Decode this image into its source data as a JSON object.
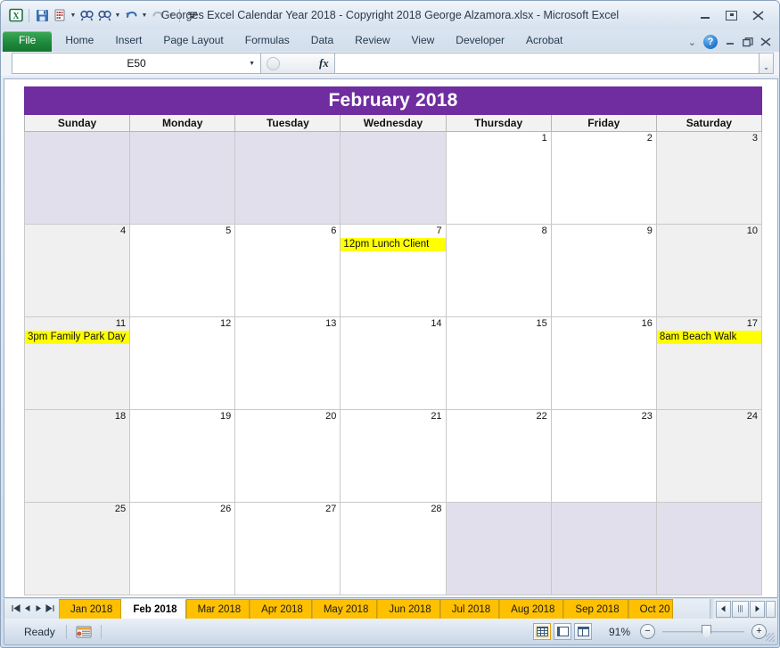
{
  "window": {
    "title": "Georges Excel Calendar Year 2018  -  Copyright 2018 George Alzamora.xlsx - Microsoft Excel",
    "minimize_label": "Minimize",
    "restore_label": "Restore Down",
    "close_label": "Close"
  },
  "quick_access": [
    {
      "name": "excel-logo-icon",
      "glyph": "X"
    },
    {
      "name": "save-icon",
      "glyph": "▣"
    },
    {
      "name": "print-preview-icon",
      "glyph": "⌸"
    },
    {
      "name": "find-icon",
      "glyph": "AA"
    },
    {
      "name": "find-next-icon",
      "glyph": "AA"
    },
    {
      "name": "undo-icon",
      "glyph": "↶"
    },
    {
      "name": "redo-icon",
      "glyph": "↷"
    },
    {
      "name": "customize-qat-icon",
      "glyph": "≡"
    }
  ],
  "ribbon": {
    "tabs": [
      {
        "label": "File",
        "active": true
      },
      {
        "label": "Home",
        "active": false
      },
      {
        "label": "Insert",
        "active": false
      },
      {
        "label": "Page Layout",
        "active": false
      },
      {
        "label": "Formulas",
        "active": false
      },
      {
        "label": "Data",
        "active": false
      },
      {
        "label": "Review",
        "active": false
      },
      {
        "label": "View",
        "active": false
      },
      {
        "label": "Developer",
        "active": false
      },
      {
        "label": "Acrobat",
        "active": false
      }
    ],
    "collapse_ribbon_label": "⌄",
    "help_label": "?"
  },
  "formula_bar": {
    "name_box_value": "E50",
    "name_box_placeholder": "Name Box",
    "fx_label": "fx",
    "formula_value": "",
    "formula_placeholder": "",
    "expand_label": "⌄"
  },
  "calendar": {
    "title": "February 2018",
    "day_headers": [
      "Sunday",
      "Monday",
      "Tuesday",
      "Wednesday",
      "Thursday",
      "Friday",
      "Saturday"
    ],
    "header_color": "#6F2DA0",
    "event_highlight_color": "#FFFF00",
    "weekend_shade_color": "#F0F0F0",
    "blank_shade_color": "#E2DFEC",
    "weeks": [
      [
        {
          "day": "",
          "blank": true,
          "weekend": true,
          "events": []
        },
        {
          "day": "",
          "blank": true,
          "weekend": false,
          "events": []
        },
        {
          "day": "",
          "blank": true,
          "weekend": false,
          "events": []
        },
        {
          "day": "",
          "blank": true,
          "weekend": false,
          "events": []
        },
        {
          "day": "1",
          "blank": false,
          "weekend": false,
          "events": []
        },
        {
          "day": "2",
          "blank": false,
          "weekend": false,
          "events": []
        },
        {
          "day": "3",
          "blank": false,
          "weekend": true,
          "events": []
        }
      ],
      [
        {
          "day": "4",
          "blank": false,
          "weekend": true,
          "events": []
        },
        {
          "day": "5",
          "blank": false,
          "weekend": false,
          "events": []
        },
        {
          "day": "6",
          "blank": false,
          "weekend": false,
          "events": []
        },
        {
          "day": "7",
          "blank": false,
          "weekend": false,
          "events": [
            "12pm Lunch Client"
          ]
        },
        {
          "day": "8",
          "blank": false,
          "weekend": false,
          "events": []
        },
        {
          "day": "9",
          "blank": false,
          "weekend": false,
          "events": []
        },
        {
          "day": "10",
          "blank": false,
          "weekend": true,
          "events": []
        }
      ],
      [
        {
          "day": "11",
          "blank": false,
          "weekend": true,
          "events": [
            "3pm Family Park Day"
          ]
        },
        {
          "day": "12",
          "blank": false,
          "weekend": false,
          "events": []
        },
        {
          "day": "13",
          "blank": false,
          "weekend": false,
          "events": []
        },
        {
          "day": "14",
          "blank": false,
          "weekend": false,
          "events": []
        },
        {
          "day": "15",
          "blank": false,
          "weekend": false,
          "events": []
        },
        {
          "day": "16",
          "blank": false,
          "weekend": false,
          "events": []
        },
        {
          "day": "17",
          "blank": false,
          "weekend": true,
          "events": [
            "8am Beach Walk"
          ]
        }
      ],
      [
        {
          "day": "18",
          "blank": false,
          "weekend": true,
          "events": []
        },
        {
          "day": "19",
          "blank": false,
          "weekend": false,
          "events": []
        },
        {
          "day": "20",
          "blank": false,
          "weekend": false,
          "events": []
        },
        {
          "day": "21",
          "blank": false,
          "weekend": false,
          "events": []
        },
        {
          "day": "22",
          "blank": false,
          "weekend": false,
          "events": []
        },
        {
          "day": "23",
          "blank": false,
          "weekend": false,
          "events": []
        },
        {
          "day": "24",
          "blank": false,
          "weekend": true,
          "events": []
        }
      ],
      [
        {
          "day": "25",
          "blank": false,
          "weekend": true,
          "events": []
        },
        {
          "day": "26",
          "blank": false,
          "weekend": false,
          "events": []
        },
        {
          "day": "27",
          "blank": false,
          "weekend": false,
          "events": []
        },
        {
          "day": "28",
          "blank": false,
          "weekend": false,
          "events": []
        },
        {
          "day": "",
          "blank": true,
          "weekend": false,
          "events": []
        },
        {
          "day": "",
          "blank": true,
          "weekend": false,
          "events": []
        },
        {
          "day": "",
          "blank": true,
          "weekend": true,
          "events": []
        }
      ]
    ]
  },
  "sheet_tabs": {
    "nav": [
      {
        "name": "first-sheet-button",
        "glyph": "⏮"
      },
      {
        "name": "previous-sheet-button",
        "glyph": "◀"
      },
      {
        "name": "next-sheet-button",
        "glyph": "▶"
      },
      {
        "name": "last-sheet-button",
        "glyph": "⏭"
      }
    ],
    "tabs": [
      {
        "label": "Jan 2018",
        "active": false,
        "clipped": false
      },
      {
        "label": "Feb 2018",
        "active": true,
        "clipped": false
      },
      {
        "label": "Mar 2018",
        "active": false,
        "clipped": false
      },
      {
        "label": "Apr 2018",
        "active": false,
        "clipped": false
      },
      {
        "label": "May 2018",
        "active": false,
        "clipped": false
      },
      {
        "label": "Jun 2018",
        "active": false,
        "clipped": false
      },
      {
        "label": "Jul 2018",
        "active": false,
        "clipped": false
      },
      {
        "label": "Aug 2018",
        "active": false,
        "clipped": false
      },
      {
        "label": "Sep 2018",
        "active": false,
        "clipped": false
      },
      {
        "label": "Oct 20",
        "active": false,
        "clipped": true
      }
    ],
    "scroll_left_label": "◀",
    "scroll_right_label": "▶"
  },
  "status_bar": {
    "state": "Ready",
    "macro_record_icon": "record-macro-icon",
    "views": [
      {
        "name": "normal-view-button",
        "selected": true
      },
      {
        "name": "page-layout-view-button",
        "selected": false
      },
      {
        "name": "page-break-preview-button",
        "selected": false
      }
    ],
    "zoom_level": "91%",
    "zoom_out_label": "−",
    "zoom_in_label": "+"
  }
}
